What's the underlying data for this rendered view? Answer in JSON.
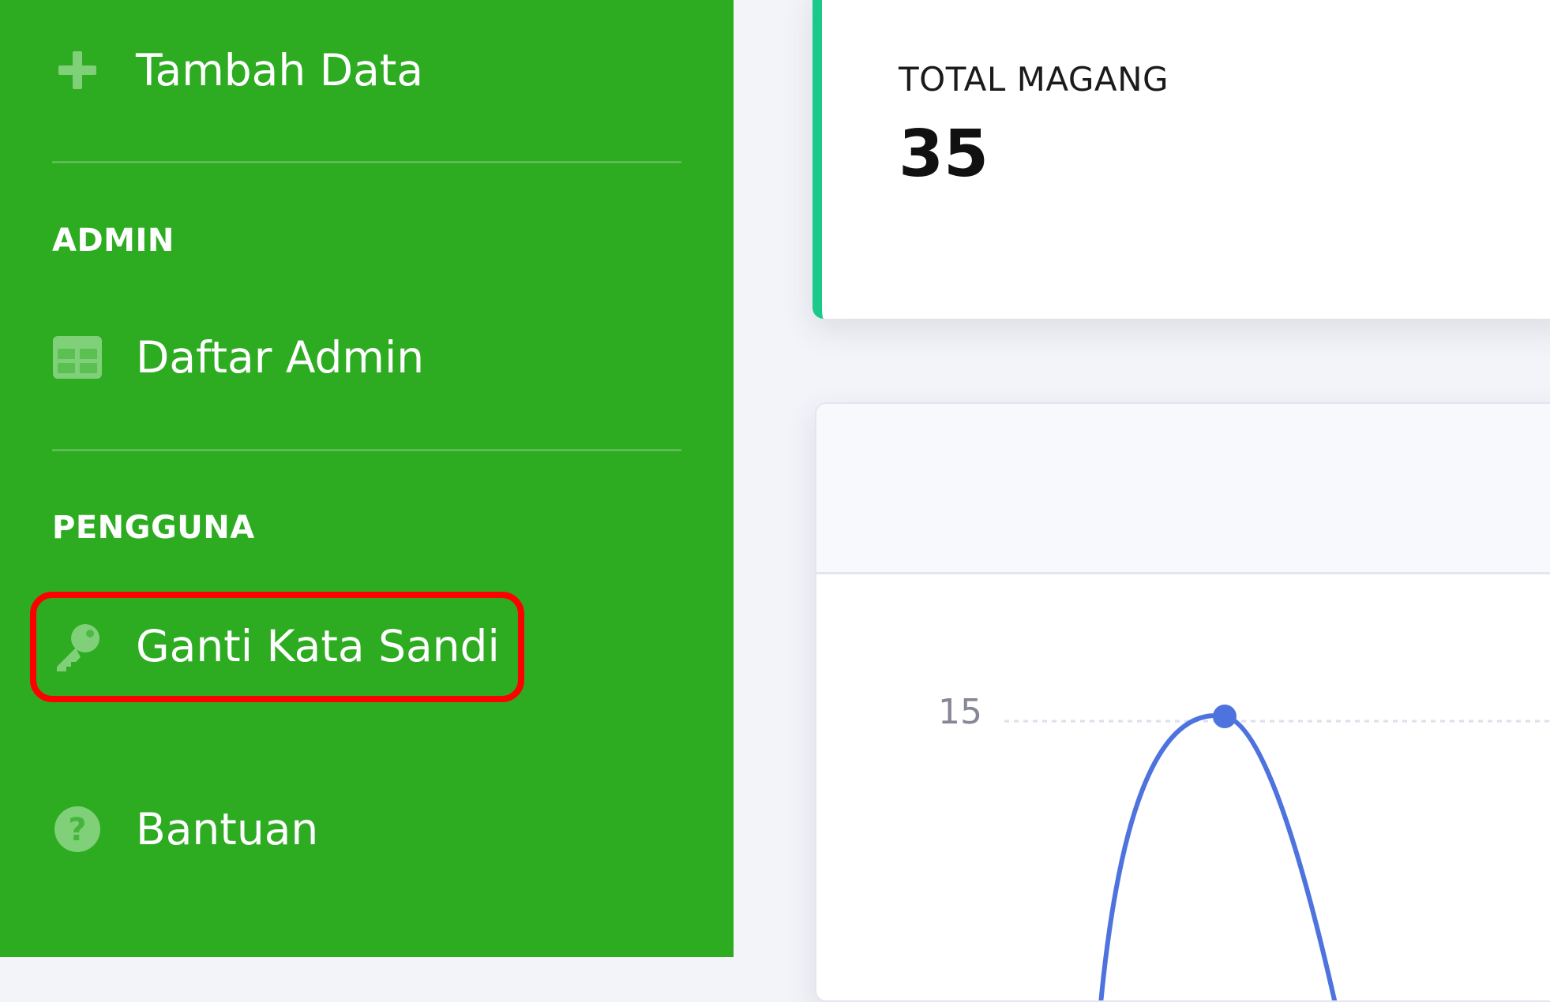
{
  "sidebar": {
    "items": [
      {
        "label": "Tambah Data",
        "icon": "plus-icon"
      },
      {
        "label": "Daftar Admin",
        "icon": "table-icon"
      },
      {
        "label": "Ganti Kata Sandi",
        "icon": "key-icon"
      },
      {
        "label": "Bantuan",
        "icon": "question-circle-icon"
      }
    ],
    "headings": {
      "admin": "ADMIN",
      "pengguna": "PENGGUNA"
    },
    "highlighted_item": "Ganti Kata Sandi"
  },
  "stat_card": {
    "label": "TOTAL MAGANG",
    "value": "35"
  },
  "chart_data": {
    "type": "line",
    "y_ticks": [
      "15"
    ],
    "series": [
      {
        "points": [
          {
            "y": 15.5
          }
        ]
      }
    ],
    "grid": true
  },
  "colors": {
    "sidebar_bg": "#2dac22",
    "icon": "#7fd078",
    "highlight": "#ff0000",
    "card_accent": "#1cc88a",
    "line": "#4e73df"
  }
}
